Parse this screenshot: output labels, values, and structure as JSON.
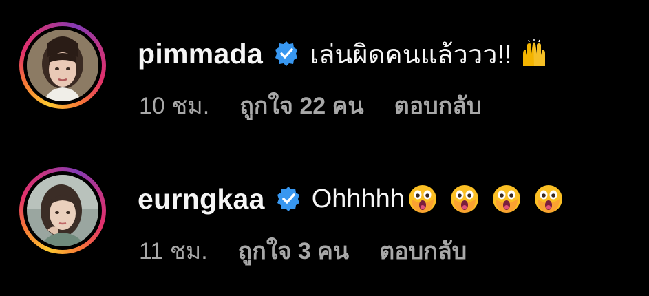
{
  "comments": [
    {
      "username": "pimmada",
      "verified": true,
      "text": "เล่นผิดคนแล้ววว!!",
      "emoji": [
        "raising-hands"
      ],
      "time": "10 ชม.",
      "likes": "ถูกใจ 22 คน",
      "reply_label": "ตอบกลับ"
    },
    {
      "username": "eurngkaa",
      "verified": true,
      "text": "Ohhhhh",
      "emoji": [
        "astonished-face",
        "astonished-face",
        "astonished-face",
        "astonished-face"
      ],
      "time": "11 ชม.",
      "likes": "ถูกใจ 3 คน",
      "reply_label": "ตอบกลับ"
    }
  ],
  "colors": {
    "background": "#000000",
    "verified_badge": "#3897f0",
    "meta_text": "#a8a8a8",
    "ring_start": "#fdc830",
    "ring_end": "#c13584"
  }
}
